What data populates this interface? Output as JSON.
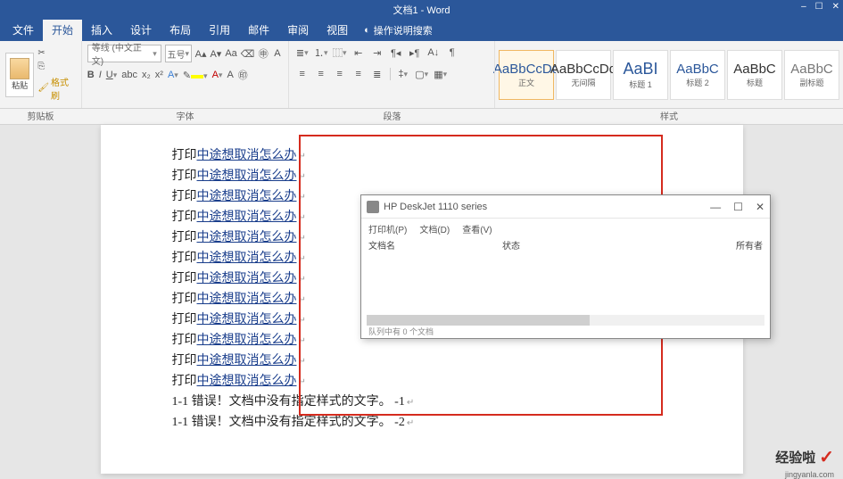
{
  "title": "文档1 - Word",
  "menu": [
    "文件",
    "开始",
    "插入",
    "设计",
    "布局",
    "引用",
    "邮件",
    "审阅",
    "视图"
  ],
  "tell_me": "操作说明搜索",
  "clipboard": {
    "paste": "粘贴",
    "format_painter": "格式刷"
  },
  "font": {
    "name": "等线 (中文正文)",
    "size": "五号"
  },
  "group_labels": {
    "clipboard": "剪贴板",
    "font": "字体",
    "paragraph": "段落",
    "styles": "样式"
  },
  "styles": [
    {
      "sample": "AaBbCcDd",
      "label": "正文"
    },
    {
      "sample": "AaBbCcDd",
      "label": "无间隔"
    },
    {
      "sample": "AaBI",
      "label": "标题 1"
    },
    {
      "sample": "AaBbC",
      "label": "标题 2"
    },
    {
      "sample": "AaBbC",
      "label": "标题"
    },
    {
      "sample": "AaBbC",
      "label": "副标题"
    }
  ],
  "doc_lines": [
    "打印中途想取消怎么办",
    "打印中途想取消怎么办",
    "打印中途想取消怎么办",
    "打印中途想取消怎么办",
    "打印中途想取消怎么办",
    "打印中途想取消怎么办",
    "打印中途想取消怎么办",
    "打印中途想取消怎么办",
    "打印中途想取消怎么办",
    "打印中途想取消怎么办",
    "打印中途想取消怎么办",
    "打印中途想取消怎么办"
  ],
  "error_lines": [
    {
      "num": "1-1",
      "text": "错误！文档中没有指定样式的文字。",
      "suf": "-1"
    },
    {
      "num": "1-1",
      "text": "错误！文档中没有指定样式的文字。",
      "suf": "-2"
    }
  ],
  "dialog": {
    "title": "HP DeskJet 1110 series",
    "menu": [
      "打印机(P)",
      "文档(D)",
      "查看(V)"
    ],
    "cols": {
      "name": "文档名",
      "status": "状态",
      "owner": "所有者"
    },
    "status": "队列中有 0 个文档"
  },
  "watermark": {
    "text": "经验啦",
    "url": "jingyanla.com"
  }
}
